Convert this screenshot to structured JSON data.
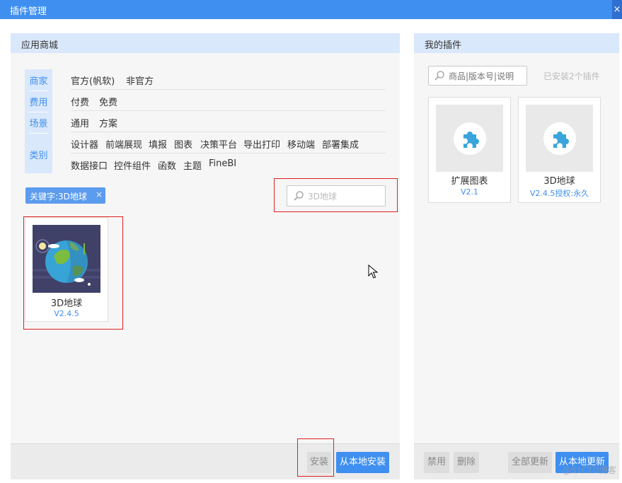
{
  "window": {
    "title": "插件管理",
    "close_glyph": "×"
  },
  "store": {
    "header": "应用商城",
    "filter_labels": [
      "商家",
      "费用",
      "场景",
      "类别"
    ],
    "filters": {
      "vendor": [
        "官方(帆软)",
        "非官方"
      ],
      "fee": [
        "付费",
        "免费"
      ],
      "scene": [
        "通用",
        "方案"
      ],
      "category_row1": [
        "设计器",
        "前端展现",
        "填报",
        "图表",
        "决策平台",
        "导出打印",
        "移动端",
        "部署集成"
      ],
      "category_row2": [
        "数据接口",
        "控件组件",
        "函数",
        "主题",
        "FineBI"
      ]
    },
    "keyword_tag": {
      "label": "关键字:3D地球",
      "remove_glyph": "×"
    },
    "search": {
      "value": "3D地球"
    },
    "results": [
      {
        "name": "3D地球",
        "version": "V2.4.5"
      }
    ],
    "buttons": {
      "install": "安装",
      "install_local": "从本地安装"
    }
  },
  "mine": {
    "header": "我的插件",
    "search": {
      "placeholder": "商品|版本号|说明"
    },
    "installed_count": "已安装2个插件",
    "plugins": [
      {
        "name": "扩展图表",
        "version": "V2.1"
      },
      {
        "name": "3D地球",
        "version": "V2.4.5授权:永久"
      }
    ],
    "buttons": {
      "disable": "禁用",
      "delete": "删除",
      "update_all": "全部更新",
      "update_local": "从本地更新"
    }
  },
  "watermark": "@51CTO博客",
  "colors": {
    "accent": "#3f8ff0",
    "header_bg": "#d9e8fb",
    "highlight_box": "#e02020",
    "globe_bg": "#404168"
  },
  "icons": [
    "search-icon",
    "puzzle-icon",
    "close-icon",
    "mouse-cursor-icon",
    "globe-icon"
  ]
}
